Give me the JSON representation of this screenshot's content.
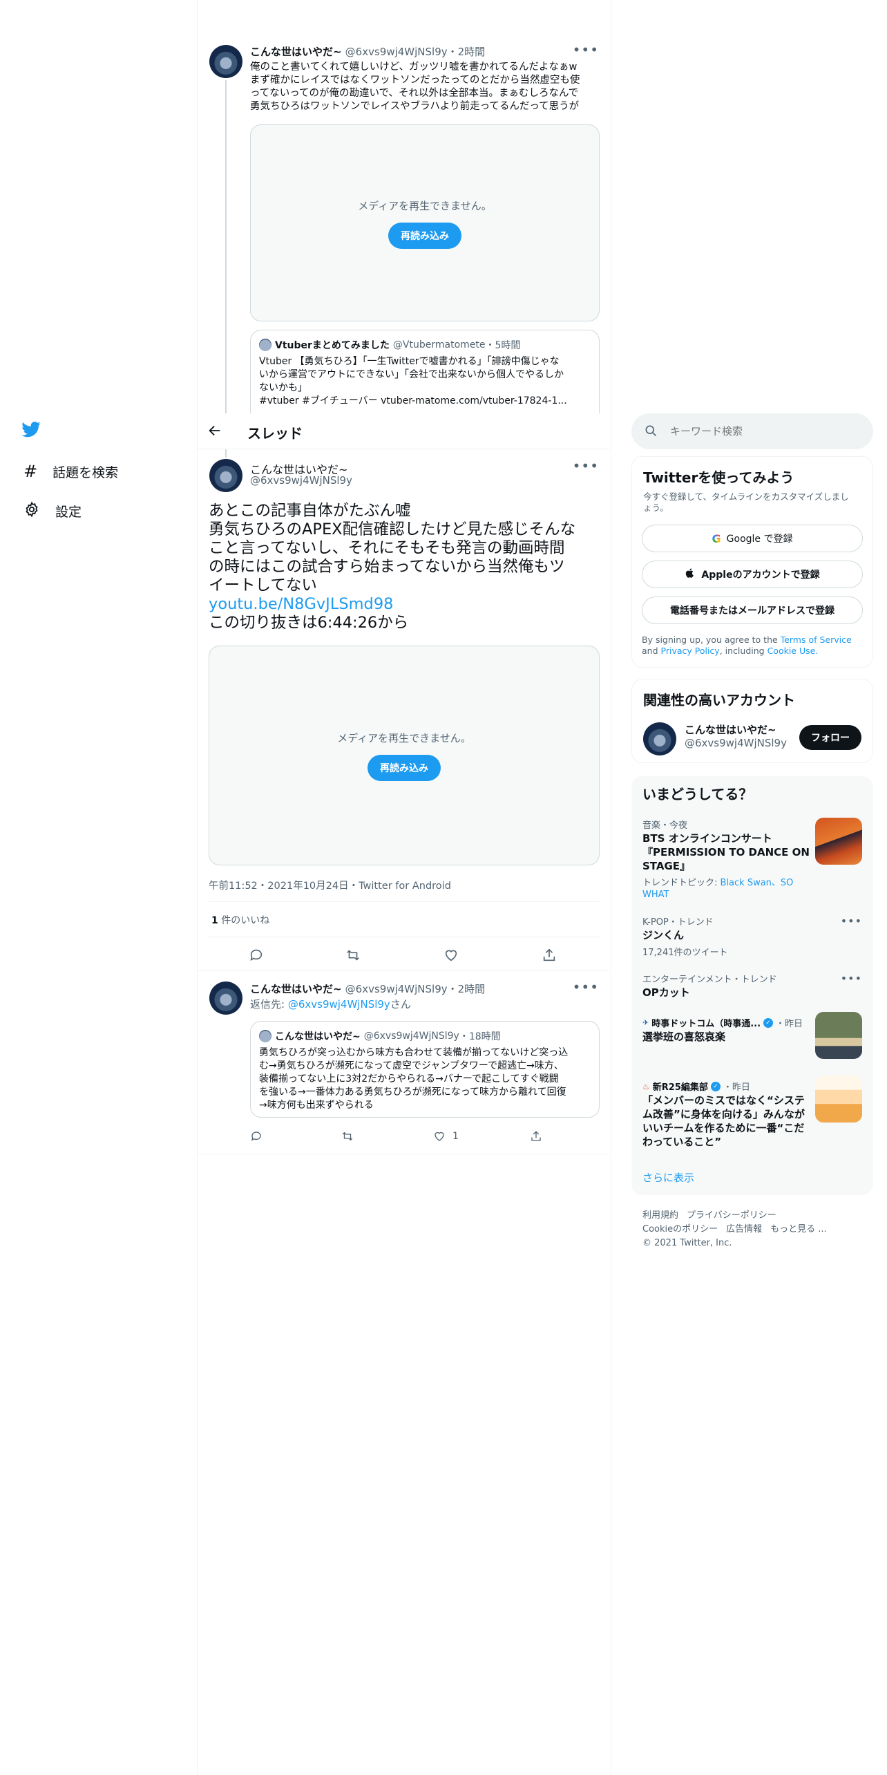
{
  "nav": {
    "explore": "話題を検索",
    "settings": "設定"
  },
  "header": {
    "title": "スレッド"
  },
  "tweet1": {
    "name": "こんな世はいやだ~",
    "handle": "@6xvs9wj4WjNSl9y",
    "time": "・2時間",
    "lines": [
      "俺のこと書いてくれて嬉しいけど、ガッツリ嘘を書かれてるんだよなぁw",
      "まず確かにレイスではなくワットソンだったってのとだから当然虚空も使",
      "ってないってのが俺の勘違いで、それ以外は全部本当。まぁむしろなんで",
      "勇気ちひろはワットソンでレイスやブラハより前走ってるんだって思うが"
    ],
    "media_msg": "メディアを再生できません。",
    "reload": "再読み込み",
    "quote": {
      "name": "Vtuberまとめてみました",
      "handle": "@Vtubermatomete",
      "time": "・5時間",
      "lines": [
        "Vtuber 【勇気ちひろ】「一生Twitterで嘘書かれる」「誹謗中傷じゃな",
        "いから運営でアウトにできない」「会社で出来ないから個人でやるしか",
        "ないかも」",
        "#vtuber #ブイチューバー vtuber-matome.com/vtuber-17824-1..."
      ]
    }
  },
  "main_tweet": {
    "name": "こんな世はいやだ~",
    "handle": "@6xvs9wj4WjNSl9y",
    "lines": [
      "あとこの記事自体がたぶん嘘",
      "勇気ちひろのAPEX配信確認したけど見た感じそんな",
      "こと言ってないし、それにそもそも発言の動画時間",
      "の時にはこの試合すら始まってないから当然俺もツ",
      "イートしてない"
    ],
    "link": "youtu.be/N8GvJLSmd98",
    "last_line": "この切り抜きは6:44:26から",
    "media_msg": "メディアを再生できません。",
    "reload": "再読み込み",
    "timestamp": "午前11:52・2021年10月24日・Twitter for Android",
    "likes_count": "1",
    "likes_label": "件のいいね"
  },
  "reply": {
    "name": "こんな世はいやだ~",
    "handle": "@6xvs9wj4WjNSl9y",
    "time": "・2時間",
    "reply_to_prefix": "返信先:",
    "reply_to_handle": "@6xvs9wj4WjNSl9y",
    "reply_to_suffix": "さん",
    "quote": {
      "name": "こんな世はいやだ~",
      "handle": "@6xvs9wj4WjNSl9y",
      "time": "・18時間",
      "lines": [
        "勇気ちひろが突っ込むから味方も合わせて装備が揃ってないけど突っ込",
        "む→勇気ちひろが瀕死になって虚空でジャンプタワーで超逃亡→味方、",
        "装備揃ってない上に3対2だからやられる→バナーで起こしてすぐ戦闘",
        "を強いる→一番体力ある勇気ちひろが瀕死になって味方から離れて回復",
        "→味方何も出来ずやられる"
      ]
    },
    "like_count": "1"
  },
  "search": {
    "placeholder": "キーワード検索"
  },
  "signup": {
    "title": "Twitterを使ってみよう",
    "desc_lines": [
      "今すぐ登録して、タイムラインをカスタマイズしまし",
      "ょう。"
    ],
    "google": "Google で登録",
    "apple": "Appleのアカウントで登録",
    "phone": "電話番号またはメールアドレスで登録",
    "legal_prefix": "By signing up, you agree to the",
    "terms": "Terms of Service",
    "and": "and",
    "privacy": "Privacy Policy",
    "including": ", including",
    "cookie": "Cookie Use."
  },
  "related": {
    "title": "関連性の高いアカウント",
    "name": "こんな世はいやだ~",
    "handle": "@6xvs9wj4WjNSl9y",
    "follow": "フォロー"
  },
  "trends": {
    "title": "いまどうしてる？",
    "items": [
      {
        "meta": "音楽・今夜",
        "title_lines": [
          "BTS オンラインコンサート",
          "『PERMISSION TO DANCE ON",
          "STAGE』"
        ],
        "sub_prefix": "トレンドトピック:",
        "sub_links": [
          "Black Swan、SO",
          "WHAT"
        ]
      },
      {
        "meta": "K-POP・トレンド",
        "title": "ジンくん",
        "sub": "17,241件のツイート"
      },
      {
        "meta": "エンターテインメント・トレンド",
        "title": "OPカット"
      },
      {
        "source": "時事ドットコム（時事通...",
        "time": "・昨日",
        "title": "選挙班の喜怒哀楽"
      },
      {
        "source": "新R25編集部",
        "time": "・昨日",
        "title_lines": [
          "「メンバーのミスではなく“システ",
          "ム改善”に身体を向ける」みんなが",
          "いいチームを作るために一番“こだ",
          "わっていること”"
        ]
      }
    ],
    "more": "さらに表示"
  },
  "footer": {
    "row1": [
      "利用規約",
      "プライバシーポリシー"
    ],
    "row2": [
      "Cookieのポリシー",
      "広告情報",
      "もっと見る ..."
    ],
    "copyright": "© 2021 Twitter, Inc."
  },
  "colors": {
    "accent": "#1d9bf0",
    "text": "#0f1419",
    "secondary": "#536471",
    "border": "#eff3f4"
  }
}
